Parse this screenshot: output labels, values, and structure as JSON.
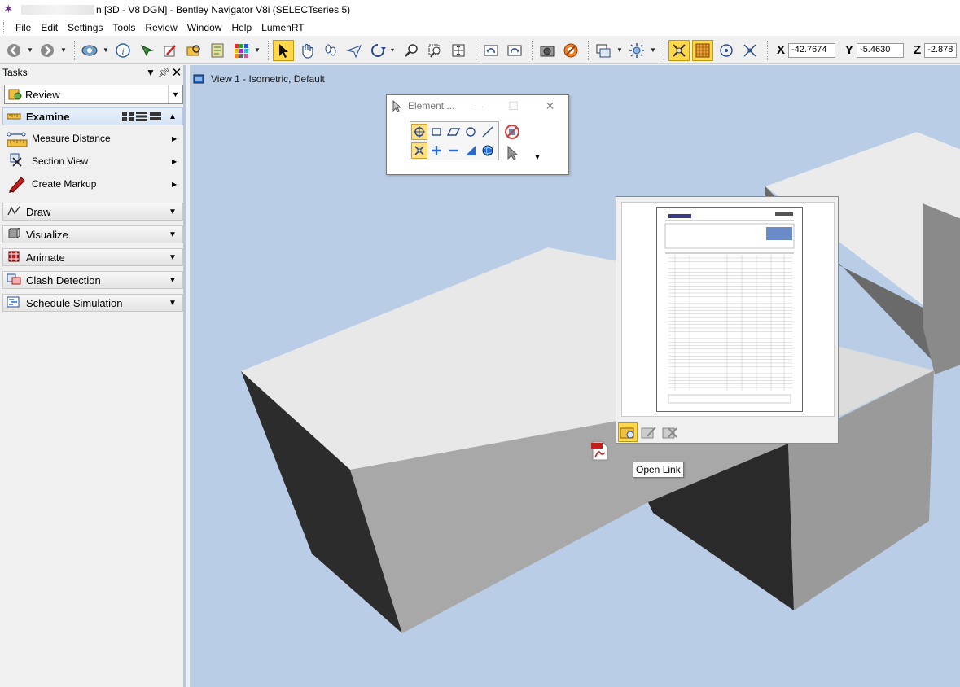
{
  "title_bar": {
    "title_suffix": "n [3D - V8 DGN] - Bentley Navigator V8i (SELECTseries 5)"
  },
  "menu": {
    "items": [
      "File",
      "Edit",
      "Settings",
      "Tools",
      "Review",
      "Window",
      "Help",
      "LumenRT"
    ]
  },
  "coords": {
    "x_label": "X",
    "x_value": "-42.7674",
    "y_label": "Y",
    "y_value": "-5.4630",
    "z_label": "Z",
    "z_value": "-2.878"
  },
  "tasks": {
    "header": "Tasks",
    "workflow": "Review",
    "examine": {
      "label": "Examine",
      "items": [
        {
          "label": "Measure Distance",
          "icon": "measure-distance-icon"
        },
        {
          "label": "Section View",
          "icon": "section-view-icon"
        },
        {
          "label": "Create Markup",
          "icon": "create-markup-icon"
        }
      ]
    },
    "sections": [
      {
        "label": "Draw",
        "icon": "draw-icon"
      },
      {
        "label": "Visualize",
        "icon": "visualize-icon"
      },
      {
        "label": "Animate",
        "icon": "animate-icon"
      },
      {
        "label": "Clash Detection",
        "icon": "clash-detection-icon"
      },
      {
        "label": "Schedule Simulation",
        "icon": "schedule-simulation-icon"
      }
    ]
  },
  "view": {
    "title": "View 1 - Isometric, Default"
  },
  "element_dialog": {
    "title": "Element ..."
  },
  "tooltip": {
    "text": "Open Link"
  },
  "colors": {
    "viewport_bg": "#b9cde6",
    "active_tool": "#ffd74a",
    "title_accent": "#6a2c91"
  }
}
